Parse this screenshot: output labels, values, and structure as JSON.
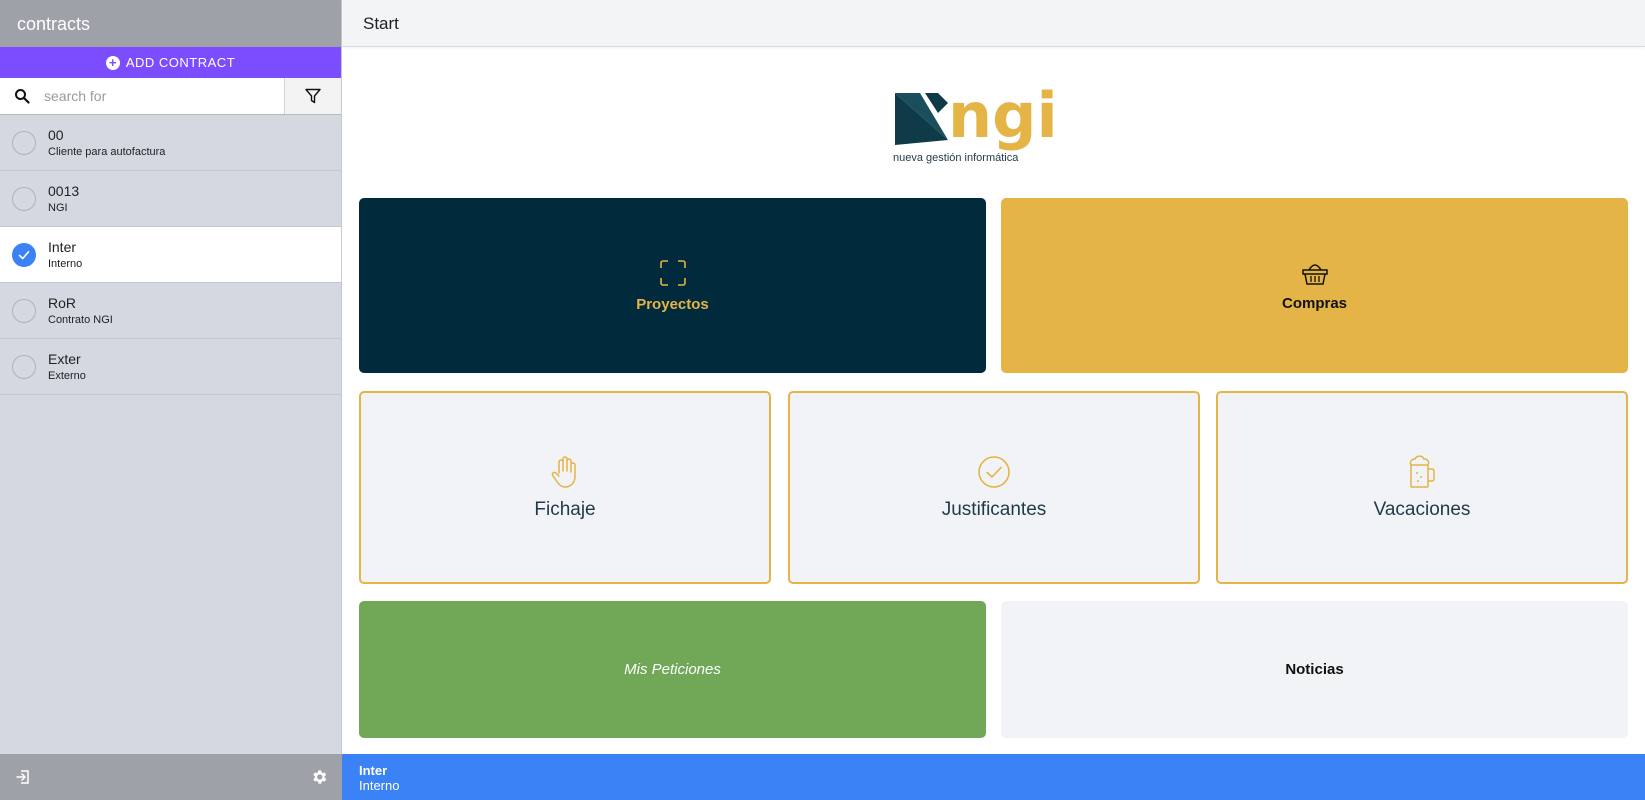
{
  "sidebar": {
    "title": "contracts",
    "add_button_label": "ADD CONTRACT",
    "search_placeholder": "search for",
    "contracts": [
      {
        "code": "00",
        "name": "Cliente para autofactura",
        "selected": false
      },
      {
        "code": "0013",
        "name": "NGI",
        "selected": false
      },
      {
        "code": "Inter",
        "name": "Interno",
        "selected": true
      },
      {
        "code": "RoR",
        "name": "Contrato NGI",
        "selected": false
      },
      {
        "code": "Exter",
        "name": "Externo",
        "selected": false
      }
    ],
    "footer_icons": [
      "logout-icon",
      "gear-icon"
    ]
  },
  "main": {
    "page_title": "Start",
    "logo": {
      "text": "ngi",
      "tagline": "nueva gestión informática"
    },
    "tiles": {
      "proyectos": "Proyectos",
      "compras": "Compras",
      "fichaje": "Fichaje",
      "justificantes": "Justificantes",
      "vacaciones": "Vacaciones",
      "peticiones": "Mis Peticiones",
      "noticias": "Noticias"
    }
  },
  "status": {
    "contract_code": "Inter",
    "contract_name": "Interno"
  },
  "colors": {
    "accent_purple": "#7b4dff",
    "navy": "#012b3c",
    "gold": "#e4b446",
    "green": "#71a857",
    "blue": "#3b82f6"
  }
}
